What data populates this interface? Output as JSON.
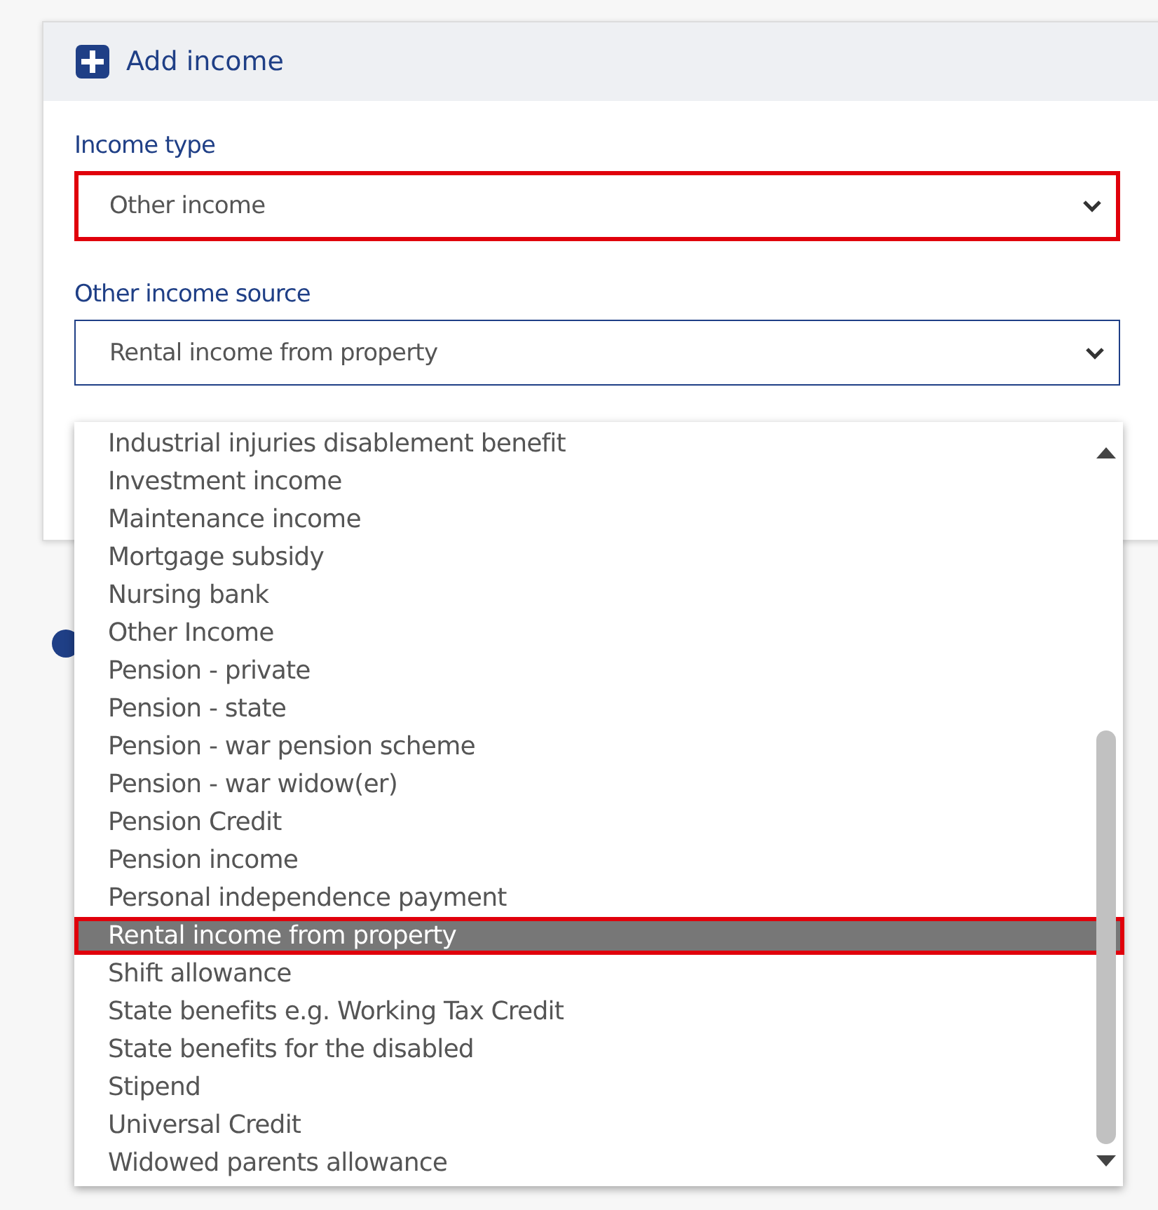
{
  "card": {
    "title": "Add income"
  },
  "fields": [
    {
      "label": "Income type",
      "value": "Other income",
      "highlighted": true,
      "focused": false
    },
    {
      "label": "Other income source",
      "value": "Rental income from property",
      "highlighted": false,
      "focused": true
    }
  ],
  "options": [
    {
      "label": "Industrial injuries disablement benefit",
      "selected": false,
      "highlighted": false
    },
    {
      "label": "Investment income",
      "selected": false,
      "highlighted": false
    },
    {
      "label": "Maintenance income",
      "selected": false,
      "highlighted": false
    },
    {
      "label": "Mortgage subsidy",
      "selected": false,
      "highlighted": false
    },
    {
      "label": "Nursing bank",
      "selected": false,
      "highlighted": false
    },
    {
      "label": "Other Income",
      "selected": false,
      "highlighted": false
    },
    {
      "label": "Pension - private",
      "selected": false,
      "highlighted": false
    },
    {
      "label": "Pension - state",
      "selected": false,
      "highlighted": false
    },
    {
      "label": "Pension - war pension scheme",
      "selected": false,
      "highlighted": false
    },
    {
      "label": "Pension - war widow(er)",
      "selected": false,
      "highlighted": false
    },
    {
      "label": "Pension Credit",
      "selected": false,
      "highlighted": false
    },
    {
      "label": "Pension income",
      "selected": false,
      "highlighted": false
    },
    {
      "label": "Personal independence payment",
      "selected": false,
      "highlighted": false
    },
    {
      "label": "Rental income from property",
      "selected": true,
      "highlighted": true
    },
    {
      "label": "Shift allowance",
      "selected": false,
      "highlighted": false
    },
    {
      "label": "State benefits e.g. Working Tax Credit",
      "selected": false,
      "highlighted": false
    },
    {
      "label": "State benefits for the disabled",
      "selected": false,
      "highlighted": false
    },
    {
      "label": "Stipend",
      "selected": false,
      "highlighted": false
    },
    {
      "label": "Universal Credit",
      "selected": false,
      "highlighted": false
    },
    {
      "label": "Widowed parents allowance",
      "selected": false,
      "highlighted": false
    }
  ]
}
